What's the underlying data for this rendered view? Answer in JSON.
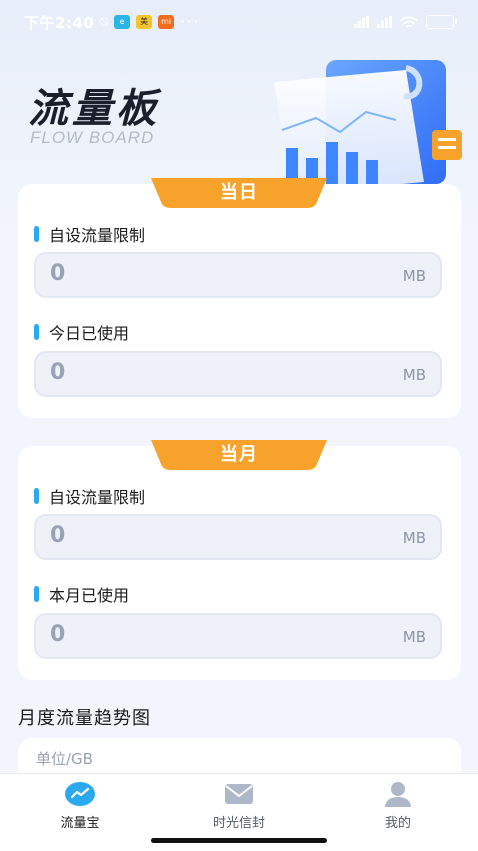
{
  "status_bar": {
    "time": "下午2:40",
    "battery": "100"
  },
  "header": {
    "title": "流量板",
    "subtitle": "FLOW BOARD"
  },
  "daily": {
    "tab": "当日",
    "limit_label": "自设流量限制",
    "limit_value": "0",
    "limit_unit": "MB",
    "used_label": "今日已使用",
    "used_value": "0",
    "used_unit": "MB"
  },
  "monthly": {
    "tab": "当月",
    "limit_label": "自设流量限制",
    "limit_value": "0",
    "limit_unit": "MB",
    "used_label": "本月已使用",
    "used_value": "0",
    "used_unit": "MB"
  },
  "trend": {
    "title": "月度流量趋势图",
    "unit": "单位/GB"
  },
  "nav": {
    "items": [
      {
        "label": "流量宝",
        "icon": "trend-icon",
        "active": true
      },
      {
        "label": "时光信封",
        "icon": "envelope-icon",
        "active": false
      },
      {
        "label": "我的",
        "icon": "user-icon",
        "active": false
      }
    ]
  },
  "colors": {
    "accent_orange": "#f7a22b",
    "accent_blue": "#2ba9f0",
    "active_text": "#1c1c1c",
    "inactive_text": "#555b66"
  }
}
